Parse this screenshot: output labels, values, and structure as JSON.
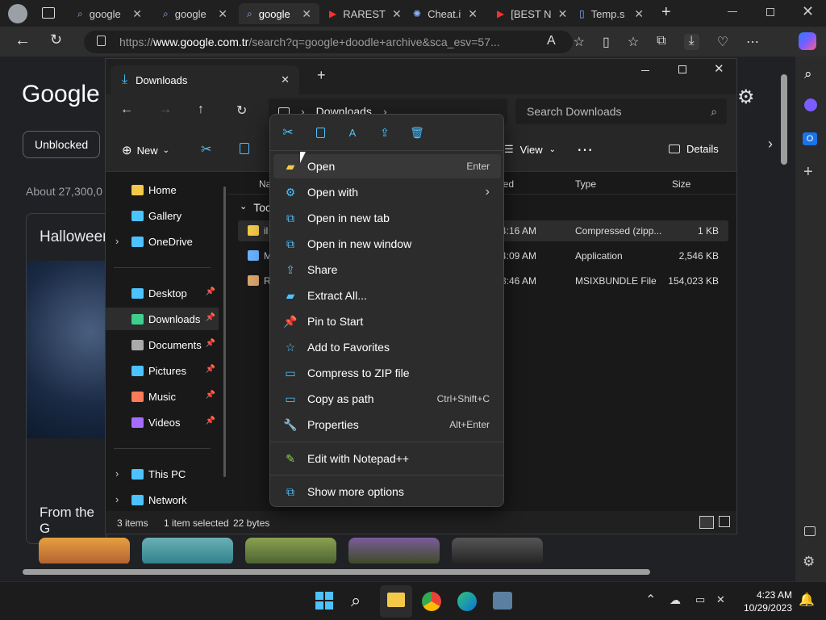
{
  "browser": {
    "tabs": [
      {
        "label": "google",
        "icon": "search-icon"
      },
      {
        "label": "google",
        "icon": "search-icon"
      },
      {
        "label": "google",
        "icon": "google-icon"
      },
      {
        "label": "RAREST",
        "icon": "youtube-icon"
      },
      {
        "label": "Cheat.i",
        "icon": "openai-icon"
      },
      {
        "label": "[BEST N",
        "icon": "youtube-icon"
      },
      {
        "label": "Temp.s",
        "icon": "page-icon"
      }
    ],
    "url_prefix": "https://",
    "url_host": "www.google.com.tr",
    "url_path": "/search?q=google+doodle+archive&sca_esv=57..."
  },
  "google": {
    "logo": "Google",
    "chip": "Unblocked",
    "result_count": "About 27,300,0",
    "card_title": "Halloween",
    "section": "From the G"
  },
  "explorer": {
    "tab_title": "Downloads",
    "breadcrumb": "Downloads",
    "search_placeholder": "Search Downloads",
    "cmd": {
      "new": "New",
      "view": "View",
      "details": "Details"
    },
    "nav": [
      {
        "label": "Home",
        "icon": "home-icon",
        "pinned": false
      },
      {
        "label": "Gallery",
        "icon": "gallery-icon",
        "pinned": false
      },
      {
        "label": "OneDrive",
        "icon": "onedrive-icon",
        "pinned": false
      },
      {
        "label": "Desktop",
        "icon": "desktop-icon",
        "pinned": true
      },
      {
        "label": "Downloads",
        "icon": "downloads-icon",
        "pinned": true
      },
      {
        "label": "Documents",
        "icon": "documents-icon",
        "pinned": true
      },
      {
        "label": "Pictures",
        "icon": "pictures-icon",
        "pinned": true
      },
      {
        "label": "Music",
        "icon": "music-icon",
        "pinned": true
      },
      {
        "label": "Videos",
        "icon": "videos-icon",
        "pinned": true
      },
      {
        "label": "This PC",
        "icon": "pc-icon",
        "pinned": false
      },
      {
        "label": "Network",
        "icon": "network-icon",
        "pinned": false
      }
    ],
    "columns": [
      "Na",
      "ied",
      "Type",
      "Size"
    ],
    "group": "Toc",
    "files": [
      {
        "name": "il",
        "time": "4:16 AM",
        "type": "Compressed (zipp...",
        "size": "1 KB"
      },
      {
        "name": "M",
        "time": "4:09 AM",
        "type": "Application",
        "size": "2,546 KB"
      },
      {
        "name": "R",
        "time": "3:46 AM",
        "type": "MSIXBUNDLE File",
        "size": "154,023 KB"
      }
    ],
    "status": {
      "count": "3 items",
      "selected": "1 item selected",
      "size": "22 bytes"
    }
  },
  "context_menu": {
    "items": [
      {
        "label": "Open",
        "shortcut": "Enter",
        "icon": "folder-open-icon"
      },
      {
        "label": "Open with",
        "shortcut": "",
        "icon": "open-with-icon",
        "submenu": true
      },
      {
        "label": "Open in new tab",
        "shortcut": "",
        "icon": "new-tab-icon"
      },
      {
        "label": "Open in new window",
        "shortcut": "",
        "icon": "new-window-icon"
      },
      {
        "label": "Share",
        "shortcut": "",
        "icon": "share-icon"
      },
      {
        "label": "Extract All...",
        "shortcut": "",
        "icon": "extract-icon"
      },
      {
        "label": "Pin to Start",
        "shortcut": "",
        "icon": "pin-icon"
      },
      {
        "label": "Add to Favorites",
        "shortcut": "",
        "icon": "star-icon"
      },
      {
        "label": "Compress to ZIP file",
        "shortcut": "",
        "icon": "zip-icon"
      },
      {
        "label": "Copy as path",
        "shortcut": "Ctrl+Shift+C",
        "icon": "copy-path-icon"
      },
      {
        "label": "Properties",
        "shortcut": "Alt+Enter",
        "icon": "properties-icon"
      }
    ],
    "extra": [
      {
        "label": "Edit with Notepad++",
        "icon": "notepadpp-icon"
      },
      {
        "label": "Show more options",
        "icon": "more-options-icon"
      }
    ]
  },
  "taskbar": {
    "time": "4:23 AM",
    "date": "10/29/2023"
  },
  "colors": {
    "accent": "#4cc2ff",
    "folder": "#f3c94a",
    "selection": "#2d2d2d"
  }
}
